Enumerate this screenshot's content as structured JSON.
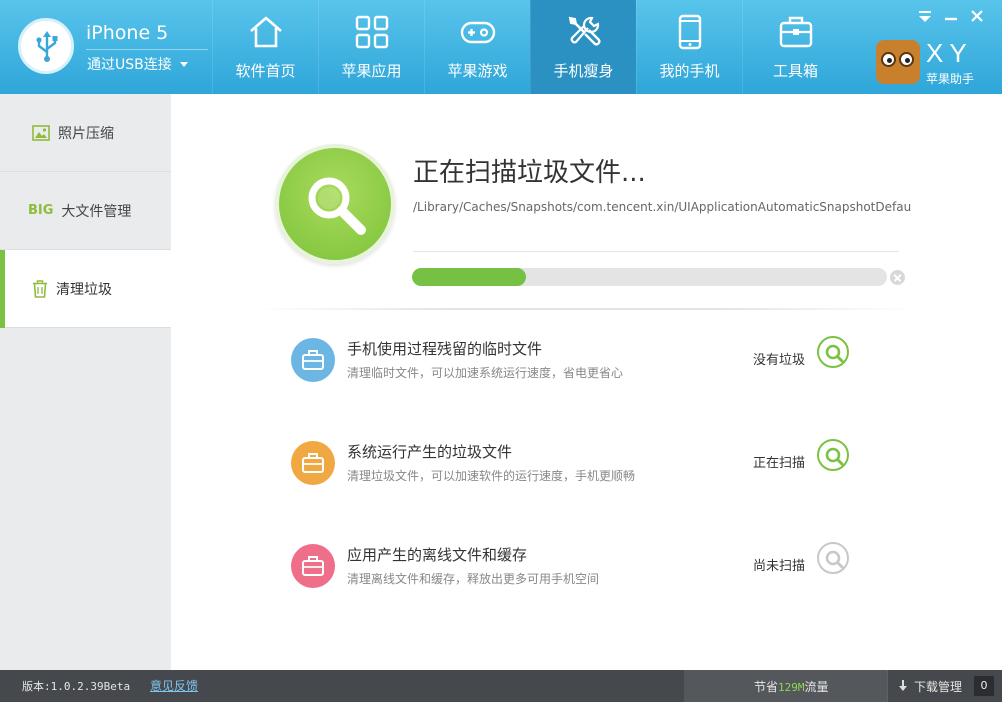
{
  "header": {
    "device_name": "iPhone 5",
    "device_connection": "通过USB连接",
    "nav": [
      {
        "label": "软件首页",
        "icon": "home-icon"
      },
      {
        "label": "苹果应用",
        "icon": "apps-grid-icon"
      },
      {
        "label": "苹果游戏",
        "icon": "gamepad-icon"
      },
      {
        "label": "手机瘦身",
        "icon": "wrench-icon",
        "active": true
      },
      {
        "label": "我的手机",
        "icon": "phone-icon"
      },
      {
        "label": "工具箱",
        "icon": "toolbox-icon"
      }
    ],
    "logo_text": "XY",
    "logo_subtitle": "苹果助手"
  },
  "sidebar": {
    "items": [
      {
        "label": "照片压缩",
        "icon": "photo-icon"
      },
      {
        "label": "大文件管理",
        "icon_text": "BIG"
      },
      {
        "label": "清理垃圾",
        "icon": "trash-icon",
        "active": true
      }
    ]
  },
  "scan": {
    "title": "正在扫描垃圾文件...",
    "path": "/Library/Caches/Snapshots/com.tencent.xin/UIApplicationAutomaticSnapshotDefault-Portra",
    "progress": 0.24
  },
  "categories": [
    {
      "title": "手机使用过程残留的临时文件",
      "desc": "清理临时文件，可以加速系统运行速度，省电更省心",
      "status": "没有垃圾",
      "color": "#6cb6e3",
      "state": "done"
    },
    {
      "title": "系统运行产生的垃圾文件",
      "desc": "清理垃圾文件，可以加速软件的运行速度，手机更顺畅",
      "status": "正在扫描",
      "color": "#f0a842",
      "state": "scanning"
    },
    {
      "title": "应用产生的离线文件和缓存",
      "desc": "清理离线文件和缓存，释放出更多可用手机空间",
      "status": "尚未扫描",
      "color": "#ef6f8a",
      "state": "pending"
    }
  ],
  "colors": {
    "header": "#3fb1e2",
    "accent_green": "#7cc242",
    "status_bar": "#45484d"
  },
  "statusbar": {
    "version": "版本:1.0.2.39Beta",
    "feedback": "意见反馈",
    "saved_prefix": "节省",
    "saved_amount": "129M",
    "saved_suffix": "流量",
    "download_label": "下载管理",
    "download_count": "0"
  }
}
